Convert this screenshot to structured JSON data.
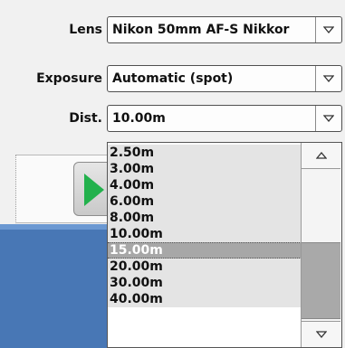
{
  "form": {
    "lens": {
      "label": "Lens",
      "value": "Nikon 50mm AF-S Nikkor"
    },
    "exposure": {
      "label": "Exposure",
      "value": "Automatic (spot)"
    },
    "distance": {
      "label": "Dist.",
      "value": "10.00m"
    }
  },
  "dropdown": {
    "options": [
      "2.50m",
      "3.00m",
      "4.00m",
      "6.00m",
      "8.00m",
      "10.00m",
      "15.00m",
      "20.00m",
      "30.00m",
      "40.00m"
    ],
    "highlighted_index": 6,
    "highlighted_value": "15.00m"
  },
  "icons": {
    "combo_arrow": "chevron-down-icon",
    "scroll_up": "triangle-up-icon",
    "scroll_down": "triangle-down-icon",
    "play": "play-icon"
  },
  "colors": {
    "play_green": "#22b14c",
    "highlight_bg": "#a7a7a7",
    "band_blue": "#4877b5"
  }
}
